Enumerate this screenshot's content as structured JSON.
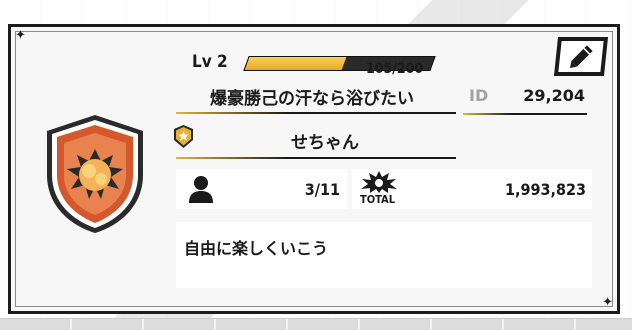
{
  "profile": {
    "level_label": "Lv 2",
    "exp_text": "105/200",
    "exp_current": 105,
    "exp_max": 200,
    "name": "爆豪勝己の汗なら浴びたい",
    "id_label": "ID",
    "id_value": "29,204",
    "title": "せちゃん",
    "friends_count": "3/11",
    "total_label": "TOTAL",
    "total_value": "1,993,823",
    "comment": "自由に楽しくいこう"
  },
  "icons": {
    "badge": "explosion-shield-badge-icon",
    "emblem": "rank-emblem-icon",
    "friends": "person-icon",
    "total": "burst-total-icon",
    "edit": "pencil-icon",
    "corner": "star-icon"
  },
  "colors": {
    "exp_fill": "#e7a92a",
    "badge_primary": "#d4582c",
    "underline_accent": "#e2b62c",
    "id_label": "#a3a3a3"
  }
}
